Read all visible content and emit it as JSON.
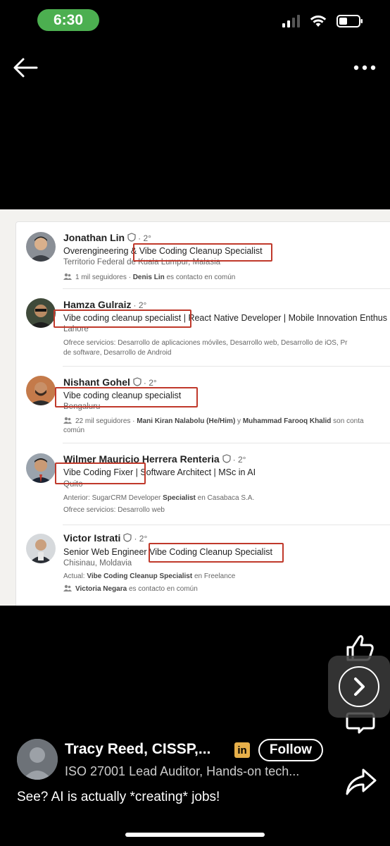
{
  "status_bar": {
    "time": "6:30"
  },
  "profiles": [
    {
      "name": "Jonathan Lin",
      "degree": "· 2°",
      "headline_pre": "Overengineering & ",
      "headline_hl": "Vibe Coding Cleanup Specialist",
      "location": "Territorio Federal de Kuala Lumpur, Malasia",
      "meta_pre": "1 mil seguidores · ",
      "meta_bold": "Denis Lin",
      "meta_post": " es contacto en común"
    },
    {
      "name": "Hamza Gulraiz",
      "degree": "· 2°",
      "headline_hl": "Vibe coding cleanup specialist |",
      "headline_post": " React Native Developer | Mobile Innovation Enthus",
      "location": "Lahore",
      "services_line1": "Ofrece servicios: Desarrollo de aplicaciones móviles, Desarrollo web, Desarrollo de iOS, Pr",
      "services_line2": "de software, Desarrollo de Android"
    },
    {
      "name": "Nishant Gohel",
      "degree": "· 2°",
      "headline_hl": "Vibe coding cleanup specialist",
      "location": "Bengaluru",
      "meta_pre": "22 mil seguidores · ",
      "meta_bold": "Mani Kiran Nalabolu (He/Him)",
      "meta_mid": " y ",
      "meta_bold2": "Muhammad Farooq Khalid",
      "meta_post": " son conta",
      "meta_line2": "común"
    },
    {
      "name": "Wilmer Mauricio Herrera Renteria",
      "degree": "· 2°",
      "headline_hl": "Vibe Coding Fixer |",
      "headline_post": " Software Architect | MSc in AI",
      "location": "Quito",
      "past_pre": "Anterior: SugarCRM Developer ",
      "past_bold": "Specialist",
      "past_post": " en Casabaca S.A.",
      "services": "Ofrece servicios: Desarrollo web"
    },
    {
      "name": "Victor Istrati",
      "degree": "· 2°",
      "headline_pre": "Senior Web Engineer ",
      "headline_hl": "Vibe Coding Cleanup Specialist",
      "location": "Chisinau, Moldavia",
      "current_pre": "Actual: ",
      "current_bold": "Vibe Coding Cleanup Specialist",
      "current_post": " en Freelance",
      "meta_bold": "Victoria Negara",
      "meta_post": " es contacto en común"
    }
  ],
  "author": {
    "name": "Tracy Reed, CISSP,...",
    "linkedin_badge": "in",
    "follow_label": "Follow",
    "headline": "ISO 27001 Lead Auditor, Hands-on tech..."
  },
  "caption": "See? AI is actually *creating* jobs!",
  "icons": [
    "back-arrow-icon",
    "more-options-icon",
    "like-icon",
    "next-icon",
    "comment-icon",
    "share-icon",
    "verified-badge-icon",
    "people-icon"
  ],
  "colors": {
    "background": "#000000",
    "time_pill": "#4caf50",
    "highlight_box": "#c0392b",
    "linkedin_badge": "#e8b04a"
  }
}
